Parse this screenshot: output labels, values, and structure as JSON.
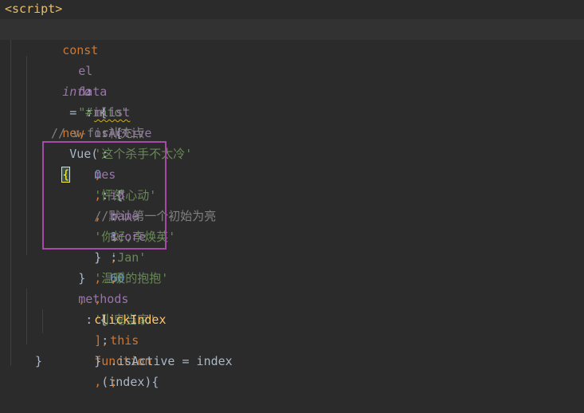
{
  "code": {
    "line1_tag": "<script>",
    "line2": {
      "const": "const",
      "var": "info",
      "eq": " = ",
      "new": "new",
      "cls": " Vue(",
      "brace": "{"
    },
    "line3": {
      "key": "el",
      "sep": " : ",
      "val": "\"#info\"",
      "comma": ","
    },
    "line4": {
      "key": "data",
      "sep": " : {"
    },
    "line5": {
      "key": "mlist",
      "sep": " : [",
      "items": [
        "'这个杀手不太冷'",
        "'怦然心动'",
        "'你好,李焕英'",
        "'温暖的抱抱'",
        "'小鬼当家'"
      ],
      "comma": ",",
      "end": "],"
    },
    "line6": {
      "key": "isActive",
      "sep": " : ",
      "num": "0",
      "comma": ",",
      "comment": "//默认第一个初始为亮"
    },
    "line7": {
      "comment": "// v-for补充点"
    },
    "line8": {
      "key": "mes",
      "sep": " : {"
    },
    "line9": {
      "key": "id",
      "sep": ": ",
      "num": "1",
      "comma": ","
    },
    "line10": {
      "key": "name",
      "sep": ": ",
      "str": "'Jan'",
      "comma": ","
    },
    "line11": {
      "key": "score",
      "sep": ": ",
      "num": "60"
    },
    "line12": {
      "close": "}",
      "comma": ","
    },
    "line13": {
      "close": "}",
      "comma": ","
    },
    "line14": {
      "key": "methods",
      "sep": " : {"
    },
    "line15": {
      "fn": "clickIndex",
      "sep": " : ",
      "kw": "function",
      "params": " (index){"
    },
    "line16": {
      "this": "this",
      "prop": ".isActive = index",
      "semi": ";"
    },
    "line17": {
      "close": "}",
      "comma": ","
    },
    "line18": {
      "close": "}"
    }
  },
  "colors": {
    "background": "#2b2b2b",
    "highlight_box": "#a64aa8",
    "keyword": "#cc7832",
    "string": "#6a8759",
    "number": "#6897bb",
    "comment": "#808080",
    "property": "#9876aa"
  }
}
